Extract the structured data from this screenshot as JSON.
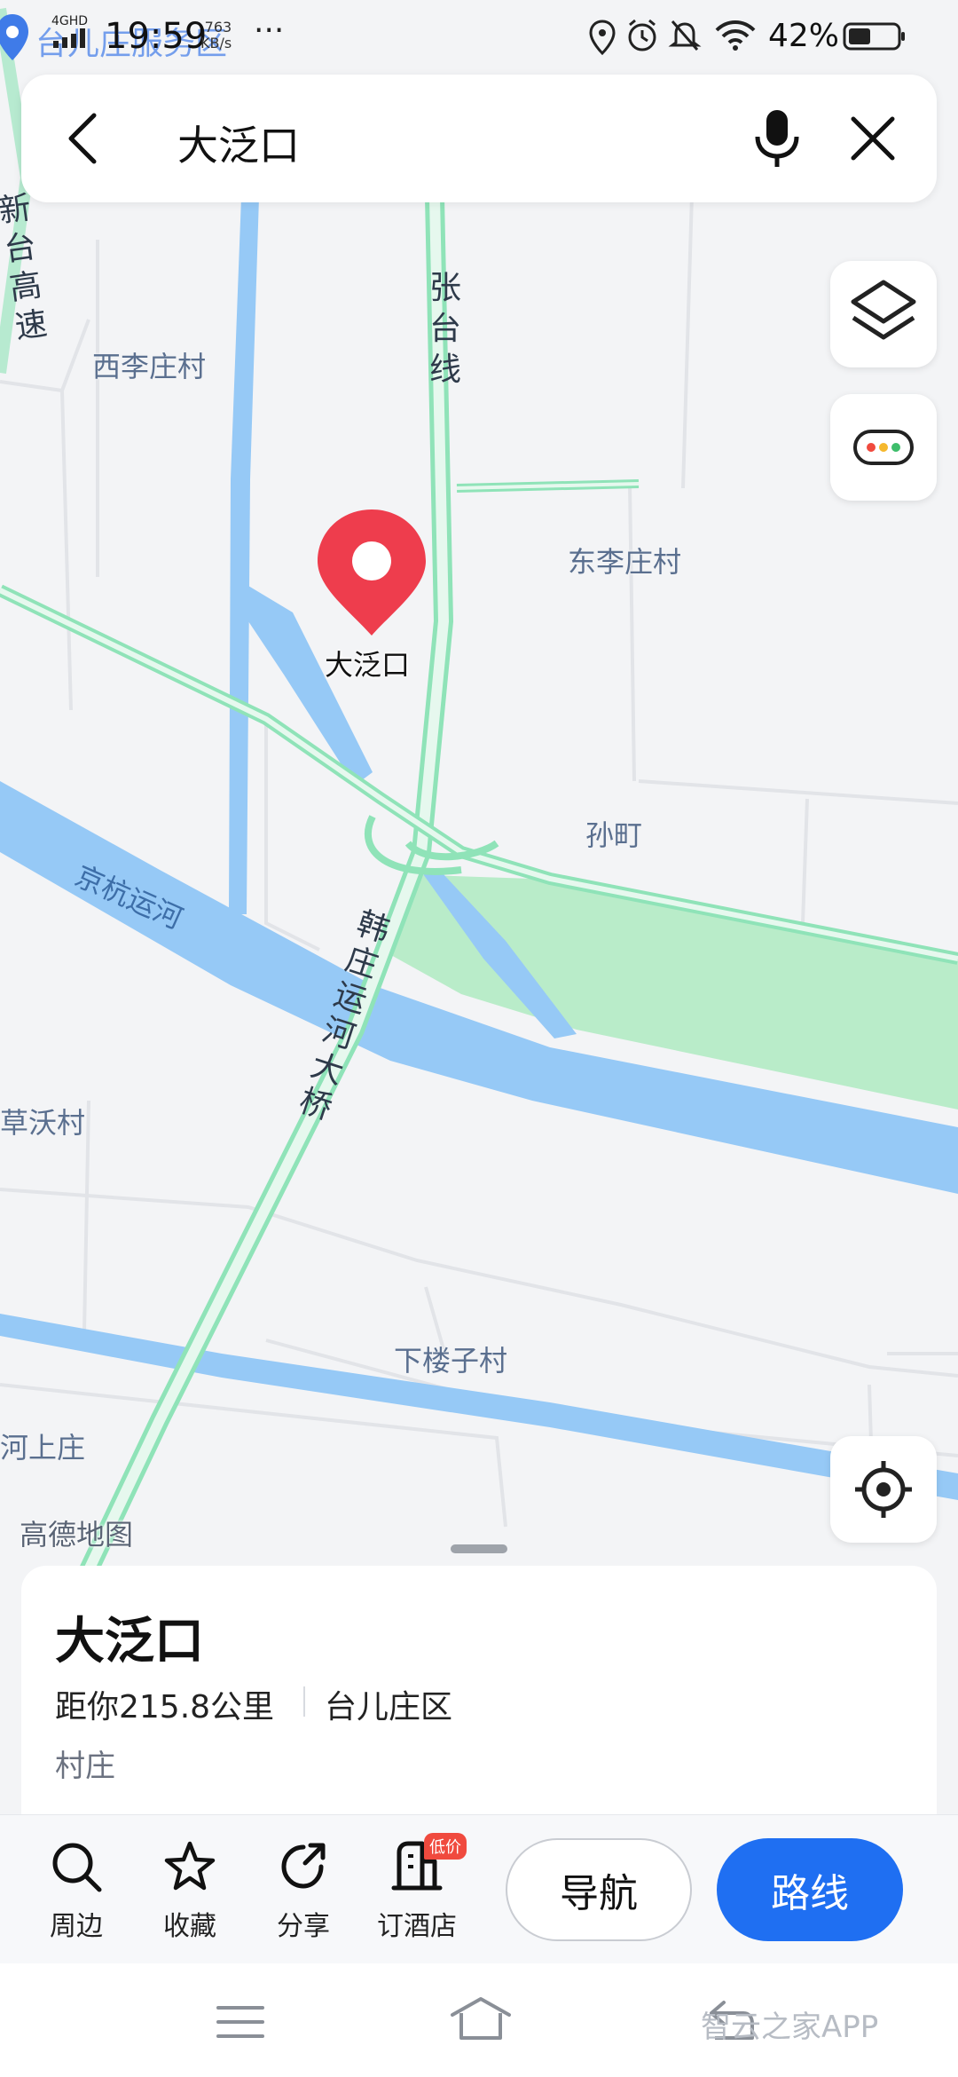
{
  "status_bar": {
    "time": "19:59",
    "network_speed": "763",
    "network_unit": "KB/s",
    "network_type": "4GHD",
    "carrier_text": "台儿庄服务区",
    "more": "···",
    "battery": "42%"
  },
  "search": {
    "query": "大泛口",
    "back_icon": "back-arrow-icon",
    "mic_icon": "microphone-icon",
    "close_icon": "close-icon"
  },
  "map": {
    "pin_label": "大泛口",
    "places": [
      {
        "key": "xilizhuang",
        "text": "西李庄村"
      },
      {
        "key": "donglizhuang",
        "text": "东李庄村"
      },
      {
        "key": "sunting",
        "text": "孙町"
      },
      {
        "key": "caowo",
        "text": "草沃村"
      },
      {
        "key": "xialouzi",
        "text": "下楼子村"
      },
      {
        "key": "heshang",
        "text": "河上庄"
      }
    ],
    "roads": {
      "zhangtai": "张台线",
      "xintai": "新台高速",
      "hanzhuang_bridge": "韩庄运河大桥"
    },
    "river": "京杭运河",
    "attribution": "高德地图",
    "colors": {
      "land": "#f3f4f6",
      "water": "#96c9f6",
      "green": "#b9ecc9",
      "road": "#8fe3b8",
      "pin": "#ee3d4d"
    }
  },
  "controls": {
    "layers_icon": "layers-icon",
    "traffic_icon": "traffic-light-icon",
    "locate_icon": "locate-crosshair-icon"
  },
  "place_card": {
    "title": "大泛口",
    "distance": "距你215.8公里",
    "district": "台儿庄区",
    "type": "村庄"
  },
  "actions": {
    "nearby": "周边",
    "favorite": "收藏",
    "share": "分享",
    "hotel": "订酒店",
    "hotel_badge": "低价",
    "navigate": "导航",
    "route": "路线"
  },
  "system": {
    "watermark": "智云之家APP"
  }
}
